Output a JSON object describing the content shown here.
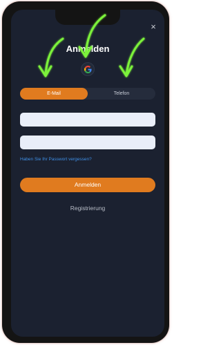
{
  "modal": {
    "title": "Anmelden",
    "close_icon": "×"
  },
  "social": {
    "google_icon": "google-g-logo"
  },
  "tabs": [
    {
      "label": "E-Mail",
      "active": true
    },
    {
      "label": "Telefon",
      "active": false
    }
  ],
  "form": {
    "email_value": "",
    "password_value": "",
    "forgot_label": "Haben Sie Ihr Passwort vergessen?",
    "login_label": "Anmelden",
    "register_label": "Registrierung"
  },
  "colors": {
    "accent": "#e07b1f",
    "background": "#1b2130",
    "link": "#3f8fe6",
    "annotation_arrow": "#7cf23a"
  }
}
